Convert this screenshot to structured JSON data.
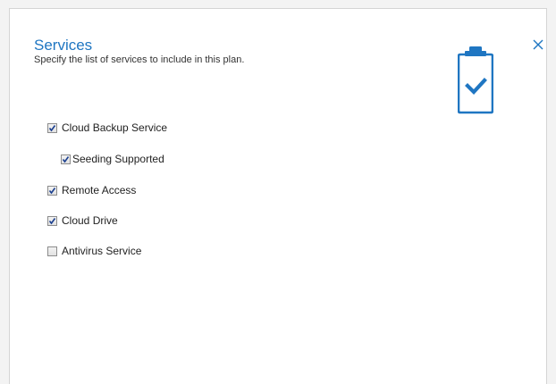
{
  "dialog": {
    "title": "Services",
    "subtitle": "Specify the list of services to include in this plan.",
    "close_icon": "close-icon",
    "header_icon": "clipboard-check-icon",
    "accent_color": "#1f76c2"
  },
  "services": [
    {
      "label": "Cloud Backup Service",
      "checked": true
    },
    {
      "label": "Seeding Supported",
      "checked": true
    },
    {
      "label": "Remote Access",
      "checked": true
    },
    {
      "label": "Cloud Drive",
      "checked": true
    },
    {
      "label": "Antivirus Service",
      "checked": false
    }
  ]
}
